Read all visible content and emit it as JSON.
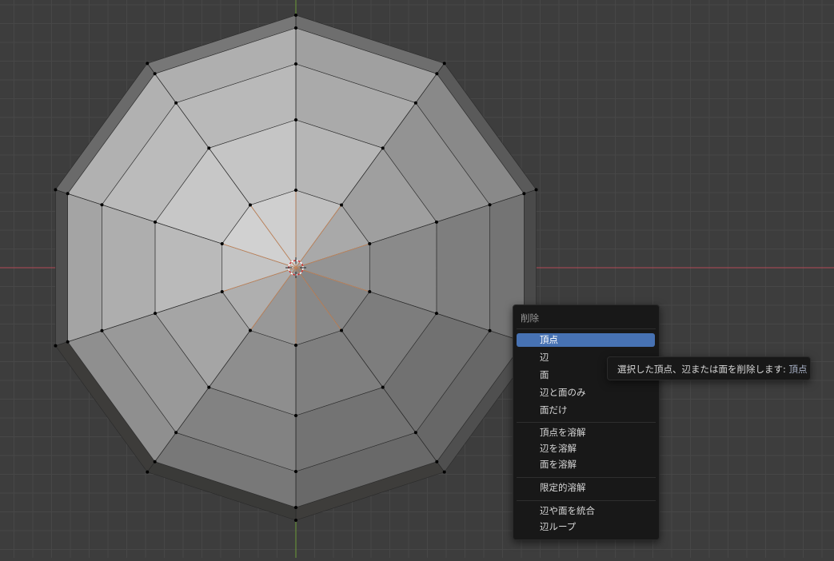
{
  "viewport": {
    "grid_color": "#4a4a4a",
    "background": "#3d3d3d",
    "x_axis_color": "#b34b56",
    "y_axis_color": "#6c9b36"
  },
  "context_menu": {
    "title": "削除",
    "items": [
      {
        "label": "頂点",
        "active": true
      },
      {
        "label": "辺"
      },
      {
        "label": "面"
      },
      {
        "label": "辺と面のみ"
      },
      {
        "label": "面だけ"
      },
      {
        "label": "頂点を溶解"
      },
      {
        "label": "辺を溶解"
      },
      {
        "label": "面を溶解"
      },
      {
        "label": "限定的溶解"
      },
      {
        "label": "辺や面を統合"
      },
      {
        "label": "辺ループ"
      }
    ]
  },
  "tooltip": {
    "text": "選択した頂点、辺または面を削除します: ",
    "highlight": "頂点"
  }
}
